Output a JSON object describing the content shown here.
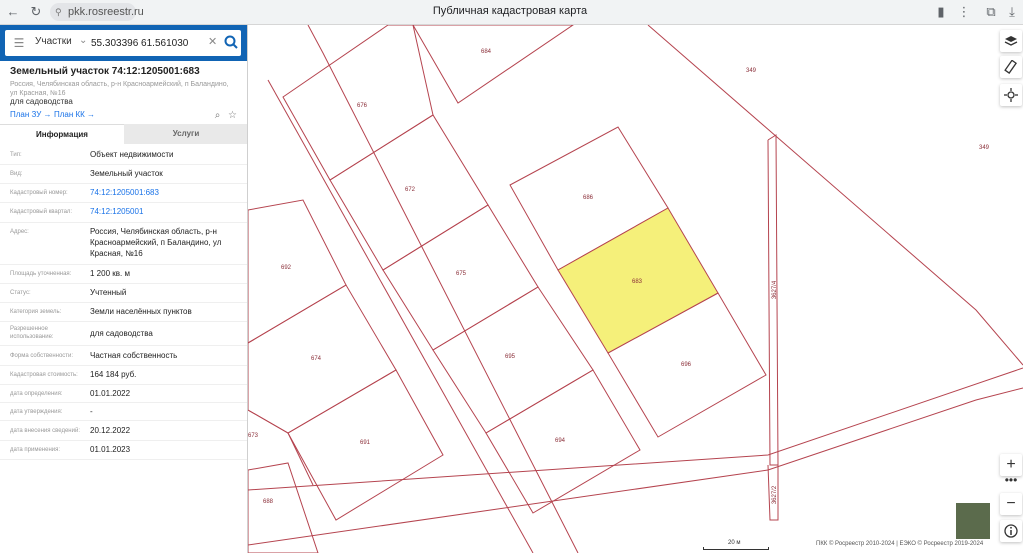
{
  "browser": {
    "url": "pkk.rosreestr.ru",
    "title": "Публичная кадастровая карта"
  },
  "search": {
    "type": "Участки",
    "query": "55.303396 61.561030"
  },
  "object": {
    "title": "Земельный участок 74:12:1205001:683",
    "address": "Россия, Челябинская область, р-н Красноармейский, п Баландино, ул Красная, №16",
    "purpose": "для садоводства",
    "plan_zu": "План ЗУ →",
    "plan_kk": "План КК →"
  },
  "tabs": {
    "info": "Информация",
    "services": "Услуги"
  },
  "info_rows": [
    {
      "label": "Тип:",
      "value": "Объект недвижимости"
    },
    {
      "label": "Вид:",
      "value": "Земельный участок"
    },
    {
      "label": "Кадастровый номер:",
      "value": "74:12:1205001:683"
    },
    {
      "label": "Кадастровый квартал:",
      "value": "74:12:1205001"
    },
    {
      "label": "Адрес:",
      "value": "Россия, Челябинская область, р-н Красноармейский, п Баландино, ул Красная, №16"
    },
    {
      "label": "Площадь уточненная:",
      "value": "1 200 кв. м"
    },
    {
      "label": "Статус:",
      "value": "Учтенный"
    },
    {
      "label": "Категория земель:",
      "value": "Земли населённых пунктов"
    },
    {
      "label": "Разрешенное использование:",
      "value": "для садоводства"
    },
    {
      "label": "Форма собственности:",
      "value": "Частная собственность"
    },
    {
      "label": "Кадастровая стоимость:",
      "value": "164 184 руб."
    },
    {
      "label": "дата определения:",
      "value": "01.01.2022"
    },
    {
      "label": "дата утверждения:",
      "value": "-"
    },
    {
      "label": "дата внесения сведений:",
      "value": "20.12.2022"
    },
    {
      "label": "дата применения:",
      "value": "01.01.2023"
    }
  ],
  "map": {
    "parcels": {
      "p676": "676",
      "p684": "684",
      "p349a": "349",
      "p349b": "349",
      "p672": "672",
      "p686": "686",
      "p692": "692",
      "p675": "675",
      "p683": "683",
      "p674": "674",
      "p695": "695",
      "p696": "696",
      "p673": "673",
      "p691": "691",
      "p694": "694",
      "p688": "688",
      "road1": "3627/4",
      "road2": "3627/2"
    },
    "selected_fill": "#f5f07a",
    "line_color": "#b5444f",
    "scale": "20 м",
    "copyright": "ПКК © Росреестр 2010-2024 | ЕЭКО © Росреестр 2019-2024"
  }
}
